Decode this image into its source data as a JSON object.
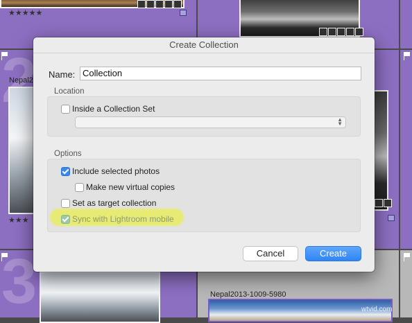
{
  "dialog": {
    "title": "Create Collection",
    "name_label": "Name:",
    "name_value": "Collection",
    "location_section": "Location",
    "inside_collection_set": {
      "label": "Inside a Collection Set",
      "checked": false
    },
    "collection_set_select": {
      "value": ""
    },
    "options_section": "Options",
    "include_selected_photos": {
      "label": "Include selected photos",
      "checked": true
    },
    "make_virtual_copies": {
      "label": "Make new virtual copies",
      "checked": false
    },
    "set_target_collection": {
      "label": "Set as target collection",
      "checked": false
    },
    "sync_lightroom_mobile": {
      "label": "Sync with Lightroom mobile",
      "checked": true,
      "disabled": true
    },
    "cancel_label": "Cancel",
    "create_label": "Create",
    "highlight_color": "#e8ef30"
  },
  "background": {
    "accent_color": "#8d6fc2",
    "filenames": {
      "left_partial": "Nepal2",
      "bottom_right": "Nepal2013-1009-5980"
    },
    "ratings": {
      "top_left": "★★★★★",
      "middle_left": "★★★"
    },
    "cell_numbers": {
      "left_middle": "2",
      "bottom_left": "3"
    },
    "watermark": "wtvid.com"
  }
}
